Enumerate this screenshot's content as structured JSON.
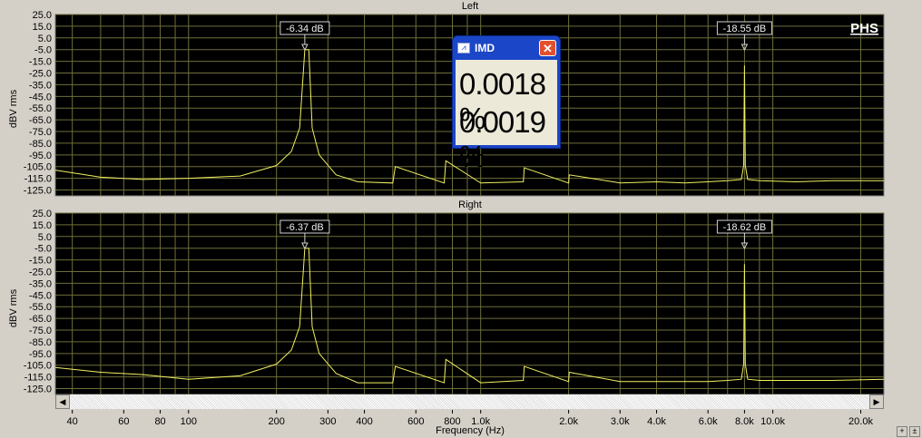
{
  "chart_data": [
    {
      "type": "line",
      "title": "Left",
      "ylabel": "dBV rms",
      "xlabel": "Frequency (Hz)",
      "xscale": "log",
      "xlim": [
        35,
        24000
      ],
      "ylim": [
        -130,
        25
      ],
      "grid": true,
      "yticks": [
        "25.0",
        "15.0",
        "5.0",
        "-5.0",
        "-15.0",
        "-25.0",
        "-35.0",
        "-45.0",
        "-55.0",
        "-65.0",
        "-75.0",
        "-85.0",
        "-95.0",
        "-105.0",
        "-115.0",
        "-125.0"
      ],
      "series": [
        {
          "color": "#f0f060",
          "x": [
            35,
            50,
            70,
            100,
            150,
            200,
            225,
            240,
            250,
            258,
            265,
            280,
            320,
            380,
            500,
            510,
            750,
            760,
            1000,
            1400,
            1410,
            2000,
            2010,
            3000,
            4000,
            5000,
            6000,
            7000,
            7800,
            7950,
            8000,
            8050,
            8200,
            9000,
            12000,
            16000,
            24000
          ],
          "y": [
            -108,
            -114,
            -116,
            -115,
            -113,
            -104,
            -92,
            -72,
            -5,
            -5,
            -72,
            -95,
            -112,
            -118,
            -119,
            -105,
            -119,
            -100,
            -119,
            -118,
            -106,
            -119,
            -112,
            -119,
            -118,
            -119,
            -118,
            -117,
            -116,
            -104,
            -18.5,
            -104,
            -116,
            -117,
            -118,
            -117,
            -117
          ]
        }
      ],
      "annotations": [
        {
          "label": "-6.34 dB",
          "x": 250,
          "y": -6.34
        },
        {
          "label": "-18.55 dB",
          "x": 8000,
          "y": -18.55
        }
      ]
    },
    {
      "type": "line",
      "title": "Right",
      "ylabel": "dBV rms",
      "xlabel": "Frequency (Hz)",
      "xscale": "log",
      "xlim": [
        35,
        24000
      ],
      "ylim": [
        -130,
        25
      ],
      "grid": true,
      "yticks": [
        "25.0",
        "15.0",
        "5.0",
        "-5.0",
        "-15.0",
        "-25.0",
        "-35.0",
        "-45.0",
        "-55.0",
        "-65.0",
        "-75.0",
        "-85.0",
        "-95.0",
        "-105.0",
        "-115.0",
        "-125.0"
      ],
      "series": [
        {
          "color": "#f0f060",
          "x": [
            35,
            50,
            70,
            100,
            150,
            200,
            225,
            240,
            250,
            258,
            265,
            280,
            320,
            380,
            500,
            510,
            750,
            760,
            1000,
            1400,
            1410,
            2000,
            2010,
            3000,
            4000,
            5000,
            6000,
            7000,
            7800,
            7950,
            8000,
            8050,
            8200,
            9000,
            12000,
            16000,
            24000
          ],
          "y": [
            -107,
            -111,
            -113,
            -117,
            -114,
            -104,
            -92,
            -72,
            -5,
            -5,
            -72,
            -95,
            -112,
            -120,
            -120,
            -106,
            -120,
            -100,
            -120,
            -118,
            -106,
            -119,
            -111,
            -119,
            -119,
            -119,
            -119,
            -118,
            -117,
            -104,
            -18.6,
            -104,
            -117,
            -118,
            -118,
            -118,
            -117
          ]
        }
      ],
      "annotations": [
        {
          "label": "-6.37 dB",
          "x": 250,
          "y": -6.37
        },
        {
          "label": "-18.62 dB",
          "x": 8000,
          "y": -18.62
        }
      ]
    }
  ],
  "xaxis": {
    "ticks": [
      {
        "v": 40,
        "label": "40"
      },
      {
        "v": 60,
        "label": "60"
      },
      {
        "v": 80,
        "label": "80"
      },
      {
        "v": 100,
        "label": "100"
      },
      {
        "v": 200,
        "label": "200"
      },
      {
        "v": 300,
        "label": "300"
      },
      {
        "v": 400,
        "label": "400"
      },
      {
        "v": 600,
        "label": "600"
      },
      {
        "v": 800,
        "label": "800"
      },
      {
        "v": 1000,
        "label": "1.0k"
      },
      {
        "v": 2000,
        "label": "2.0k"
      },
      {
        "v": 3000,
        "label": "3.0k"
      },
      {
        "v": 4000,
        "label": "4.0k"
      },
      {
        "v": 6000,
        "label": "6.0k"
      },
      {
        "v": 8000,
        "label": "8.0k"
      },
      {
        "v": 10000,
        "label": "10.0k"
      },
      {
        "v": 20000,
        "label": "20.0k"
      }
    ]
  },
  "watermark": "PHS",
  "imd_window": {
    "title": "IMD",
    "close_label": "✕",
    "value_left": "0.0018 %",
    "value_right": "0.0019 %"
  },
  "scrollbar": {
    "left_arrow": "◀",
    "right_arrow": "▶"
  },
  "zoom": {
    "plus": "+",
    "minus": "±"
  }
}
